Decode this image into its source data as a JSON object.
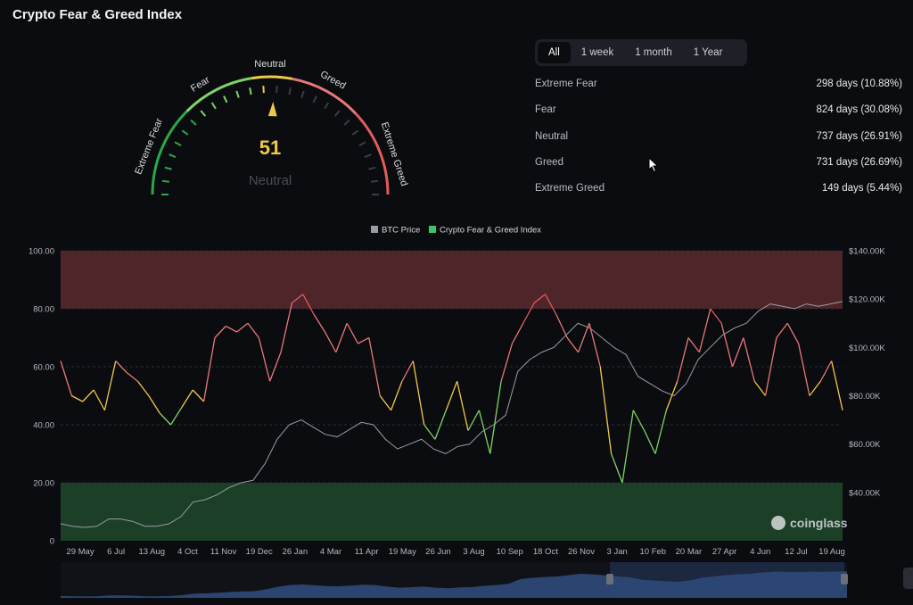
{
  "app": {
    "title": "Crypto Fear & Greed Index"
  },
  "gauge": {
    "value": 51,
    "status": "Neutral",
    "zone_labels": [
      "Extreme Fear",
      "Fear",
      "Neutral",
      "Greed",
      "Extreme Greed"
    ],
    "min": 0,
    "max": 100
  },
  "tabs": [
    {
      "label": "All",
      "active": true
    },
    {
      "label": "1 week",
      "active": false
    },
    {
      "label": "1 month",
      "active": false
    },
    {
      "label": "1 Year",
      "active": false
    }
  ],
  "stats": [
    {
      "label": "Extreme Fear",
      "value": "298 days (10.88%)"
    },
    {
      "label": "Fear",
      "value": "824 days (30.08%)"
    },
    {
      "label": "Neutral",
      "value": "737 days (26.91%)"
    },
    {
      "label": "Greed",
      "value": "731 days (26.69%)"
    },
    {
      "label": "Extreme Greed",
      "value": "149 days (5.44%)"
    }
  ],
  "watermark": "coinglass",
  "colors": {
    "extreme_fear": "#2aa84a",
    "fear": "#7fd36a",
    "neutral": "#f0c84a",
    "greed": "#e8787a",
    "extreme_greed": "#e35b5f",
    "btc_line": "#9a9ca3"
  },
  "chart_data": {
    "type": "line",
    "legend": [
      "BTC Price",
      "Crypto Fear & Greed Index"
    ],
    "legend_position": "top-center",
    "x_ticks": [
      "29 May",
      "6 Jul",
      "13 Aug",
      "4 Oct",
      "11 Nov",
      "19 Dec",
      "26 Jan",
      "4 Mar",
      "11 Apr",
      "19 May",
      "26 Jun",
      "3 Aug",
      "10 Sep",
      "18 Oct",
      "26 Nov",
      "3 Jan",
      "10 Feb",
      "20 Mar",
      "27 Apr",
      "4 Jun",
      "12 Jul",
      "19 Aug"
    ],
    "y_left": {
      "min": 0,
      "max": 100,
      "ticks": [
        "0",
        "20.00",
        "40.00",
        "60.00",
        "80.00",
        "100.00"
      ]
    },
    "y_right": {
      "min": 20,
      "max": 140,
      "ticks": [
        "$40.00K",
        "$60.00K",
        "$80.00K",
        "$100.00K",
        "$120.00K",
        "$140.00K"
      ]
    },
    "bands": [
      {
        "from": 80,
        "to": 100,
        "zone": "extreme_greed"
      },
      {
        "from": 0,
        "to": 20,
        "zone": "extreme_fear"
      }
    ],
    "series": [
      {
        "name": "Crypto Fear & Greed Index",
        "values": [
          62,
          50,
          48,
          52,
          45,
          62,
          58,
          55,
          50,
          44,
          40,
          46,
          52,
          48,
          70,
          74,
          72,
          75,
          70,
          55,
          65,
          82,
          85,
          78,
          72,
          65,
          75,
          68,
          70,
          50,
          45,
          55,
          62,
          40,
          35,
          45,
          55,
          38,
          45,
          30,
          55,
          68,
          75,
          82,
          85,
          78,
          70,
          65,
          75,
          60,
          30,
          20,
          45,
          38,
          30,
          45,
          55,
          70,
          65,
          80,
          75,
          60,
          70,
          55,
          50,
          70,
          75,
          68,
          50,
          55,
          62,
          45
        ]
      },
      {
        "name": "BTC Price",
        "values": [
          27,
          26,
          25.5,
          26,
          29,
          29,
          28,
          26,
          26,
          27,
          30,
          36,
          37,
          39,
          42,
          44,
          45,
          52,
          62,
          68,
          70,
          67,
          64,
          63,
          66,
          69,
          68,
          62,
          58,
          60,
          62,
          58,
          56,
          59,
          60,
          65,
          68,
          72,
          90,
          95,
          98,
          100,
          105,
          110,
          108,
          104,
          100,
          97,
          88,
          85,
          82,
          80,
          85,
          95,
          100,
          105,
          108,
          110,
          115,
          118,
          117,
          116,
          118,
          117,
          118,
          119
        ]
      }
    ]
  }
}
